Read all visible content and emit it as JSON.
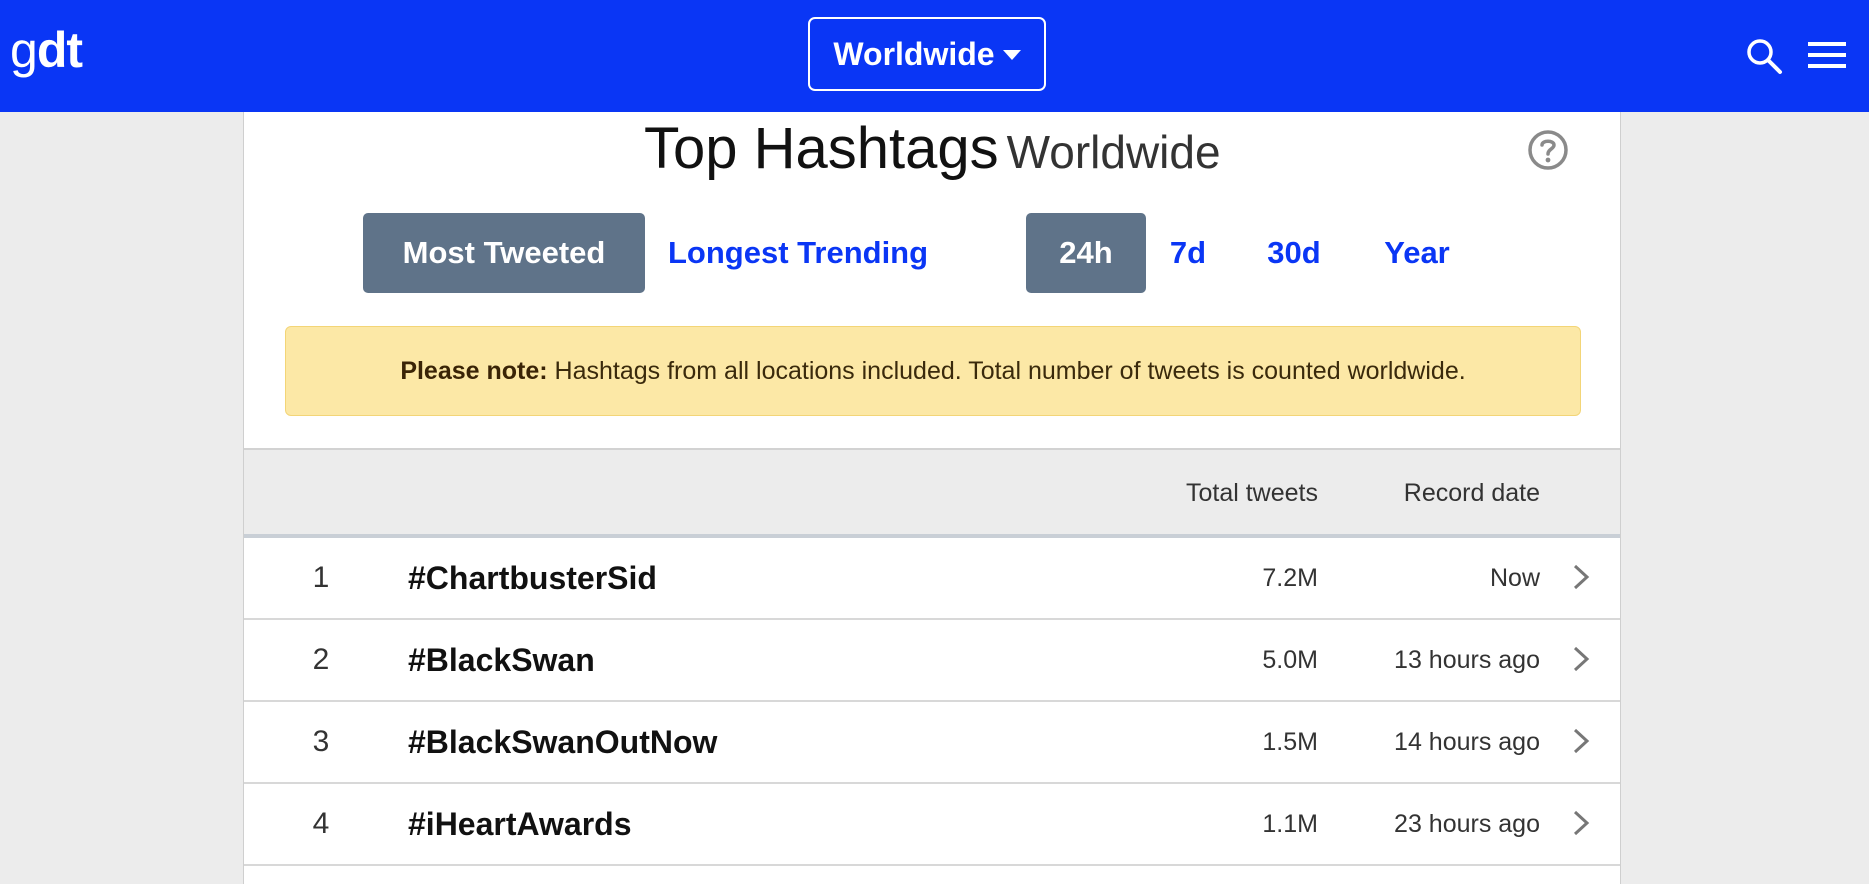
{
  "header": {
    "logo_prefix": "g",
    "logo_bold": "dt",
    "location": "Worldwide",
    "icons": [
      "chevron-down-icon",
      "search-icon",
      "menu-icon"
    ],
    "brand_color": "#0a36f5"
  },
  "page": {
    "title": "Top Hashtags",
    "subtitle": "Worldwide",
    "help_icon": "question-circle-icon"
  },
  "tabs": {
    "mode": [
      {
        "label": "Most Tweeted",
        "active": true
      },
      {
        "label": "Longest Trending",
        "active": false
      }
    ],
    "period": [
      {
        "label": "24h",
        "active": true
      },
      {
        "label": "7d",
        "active": false
      },
      {
        "label": "30d",
        "active": false
      },
      {
        "label": "Year",
        "active": false
      }
    ]
  },
  "note": {
    "label": "Please note:",
    "text": "Hashtags from all locations included. Total number of tweets is counted worldwide."
  },
  "table": {
    "columns": [
      "Total tweets",
      "Record date"
    ],
    "rows": [
      {
        "rank": "1",
        "hashtag": "#ChartbusterSid",
        "tweets": "7.2M",
        "date": "Now"
      },
      {
        "rank": "2",
        "hashtag": "#BlackSwan",
        "tweets": "5.0M",
        "date": "13 hours ago"
      },
      {
        "rank": "3",
        "hashtag": "#BlackSwanOutNow",
        "tweets": "1.5M",
        "date": "14 hours ago"
      },
      {
        "rank": "4",
        "hashtag": "#iHeartAwards",
        "tweets": "1.1M",
        "date": "23 hours ago"
      }
    ]
  }
}
